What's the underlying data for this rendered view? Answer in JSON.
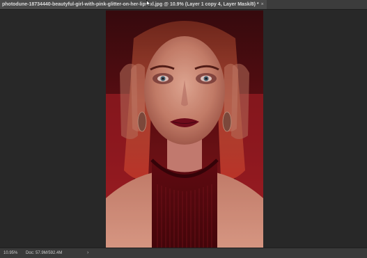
{
  "document": {
    "tab_title": "photodune-18734440-beautyful-girl-with-pink-glitter-on-her-lips-xl.jpg @ 10.9% (Layer 1 copy 4, Layer Mask/8) *",
    "close_glyph": "×"
  },
  "status": {
    "zoom": "10.95%",
    "doc_info": "Doc: 57.9M/592.4M",
    "arrow_glyph": "›"
  },
  "icons": {
    "tab_close": "close-icon",
    "status_menu": "chevron-right-icon",
    "pointer": "mouse-pointer-icon"
  },
  "colors": {
    "workspace_bg": "#282828",
    "tab_bar_bg": "#3c3c3c",
    "active_tab_bg": "#4a4a4a",
    "status_bar_bg": "#3a3a3a",
    "image_dominant_red": "#8b1418"
  }
}
